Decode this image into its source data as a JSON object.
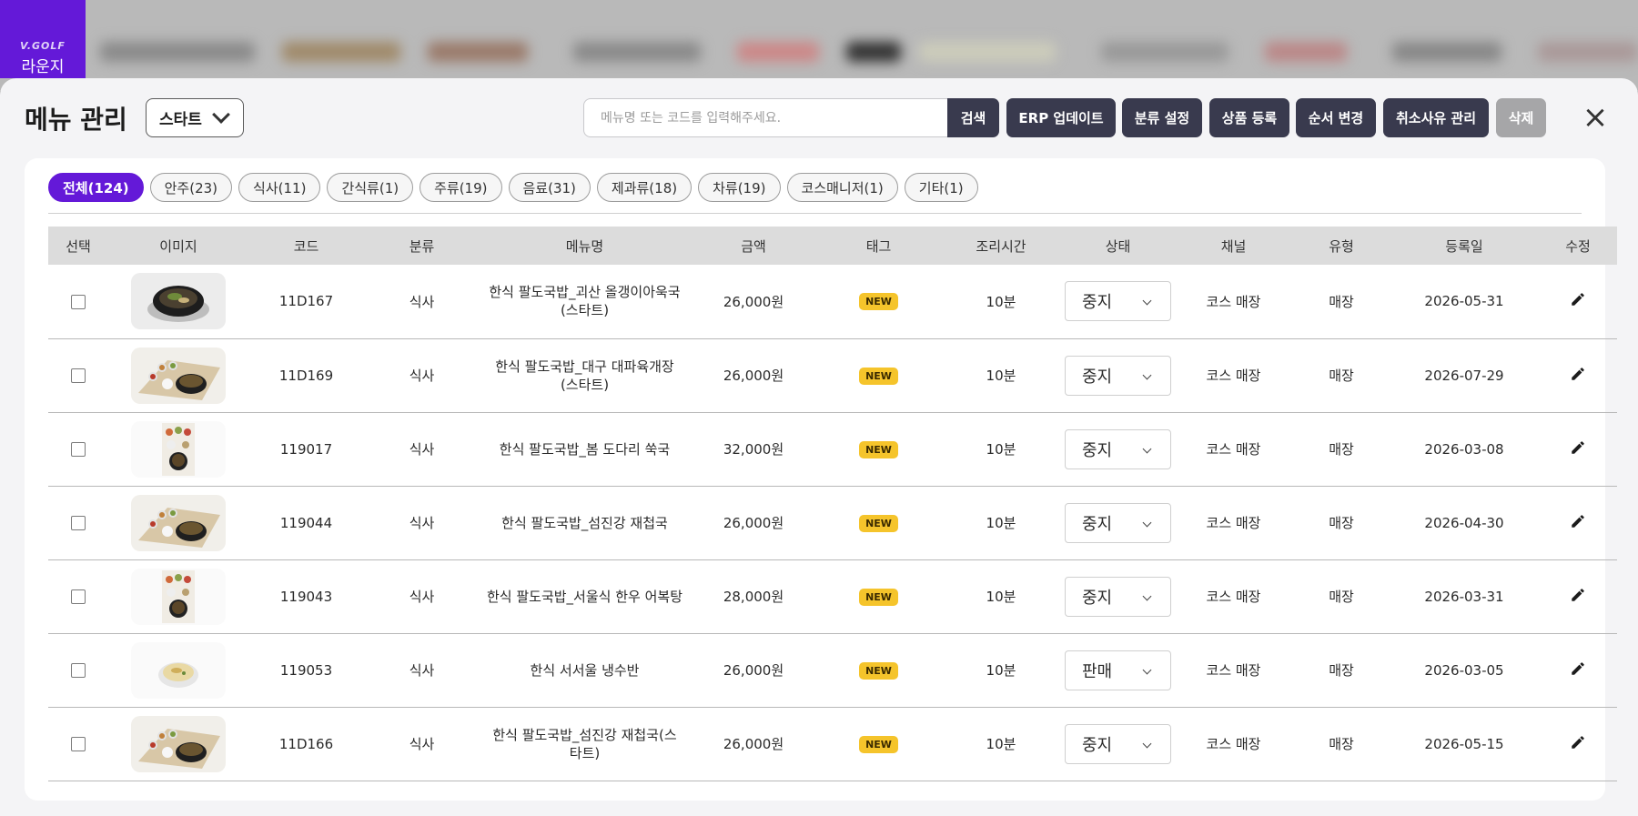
{
  "background": {
    "logo_mark": "V.GOLF",
    "logo_label": "라운지"
  },
  "header": {
    "title": "메뉴 관리",
    "store_selected": "스타트",
    "search_placeholder": "메뉴명 또는 코드를 입력해주세요.",
    "buttons": {
      "search": "검색",
      "erp_update": "ERP 업데이트",
      "category_settings": "분류 설정",
      "product_register": "상품 등록",
      "reorder": "순서 변경",
      "cancel_reason": "취소사유 관리",
      "delete": "삭제"
    },
    "close_icon": "×"
  },
  "filters": [
    "전체(124)",
    "안주(23)",
    "식사(11)",
    "간식류(1)",
    "주류(19)",
    "음료(31)",
    "제과류(18)",
    "차류(19)",
    "코스매니저(1)",
    "기타(1)"
  ],
  "active_filter_index": 0,
  "table": {
    "headers": [
      "선택",
      "이미지",
      "코드",
      "분류",
      "메뉴명",
      "금액",
      "태그",
      "조리시간",
      "상태",
      "채널",
      "유형",
      "등록일",
      "수정"
    ],
    "rows": [
      {
        "code": "11D167",
        "category": "식사",
        "name_line1": "한식 팔도국밥_괴산 올갱이아욱국",
        "name_line2": "(스타트)",
        "price": "26,000원",
        "tag": "NEW",
        "cook_time": "10분",
        "status": "중지",
        "channel": "코스 매장",
        "type": "매장",
        "date": "2026-05-31",
        "image": "stone-pot-soup"
      },
      {
        "code": "11D169",
        "category": "식사",
        "name_line1": "한식 팔도국밥_대구 대파육개장",
        "name_line2": "(스타트)",
        "price": "26,000원",
        "tag": "NEW",
        "cook_time": "10분",
        "status": "중지",
        "channel": "코스 매장",
        "type": "매장",
        "date": "2026-07-29",
        "image": "soup-set-tray"
      },
      {
        "code": "119017",
        "category": "식사",
        "name_line1": "한식 팔도국밥_봄 도다리 쑥국",
        "name_line2": "",
        "price": "32,000원",
        "tag": "NEW",
        "cook_time": "10분",
        "status": "중지",
        "channel": "코스 매장",
        "type": "매장",
        "date": "2026-03-08",
        "image": "soup-set-topdown"
      },
      {
        "code": "119044",
        "category": "식사",
        "name_line1": "한식 팔도국밥_섬진강 재첩국",
        "name_line2": "",
        "price": "26,000원",
        "tag": "NEW",
        "cook_time": "10분",
        "status": "중지",
        "channel": "코스 매장",
        "type": "매장",
        "date": "2026-04-30",
        "image": "soup-set-tray"
      },
      {
        "code": "119043",
        "category": "식사",
        "name_line1": "한식 팔도국밥_서울식 한우 어복탕",
        "name_line2": "",
        "price": "28,000원",
        "tag": "NEW",
        "cook_time": "10분",
        "status": "중지",
        "channel": "코스 매장",
        "type": "매장",
        "date": "2026-03-31",
        "image": "soup-set-topdown"
      },
      {
        "code": "119053",
        "category": "식사",
        "name_line1": "한식 서서울 냉수반",
        "name_line2": "",
        "price": "26,000원",
        "tag": "NEW",
        "cook_time": "10분",
        "status": "판매",
        "channel": "코스 매장",
        "type": "매장",
        "date": "2026-03-05",
        "image": "cold-noodle-bowl"
      },
      {
        "code": "11D166",
        "category": "식사",
        "name_line1": "한식 팔도국밥_섬진강 재첩국(스",
        "name_line2": "타트)",
        "price": "26,000원",
        "tag": "NEW",
        "cook_time": "10분",
        "status": "중지",
        "channel": "코스 매장",
        "type": "매장",
        "date": "2026-05-15",
        "image": "soup-set-tray"
      }
    ]
  },
  "colors": {
    "accent": "#6419d8",
    "dark_button": "#393a4e",
    "disabled_button": "#a6a6a8",
    "tag_yellow": "#f5c42b",
    "header_row": "#dcdcdc"
  },
  "icons": {
    "edit": "pencil-icon",
    "close": "close-icon",
    "dropdown": "chevron-down-icon"
  }
}
